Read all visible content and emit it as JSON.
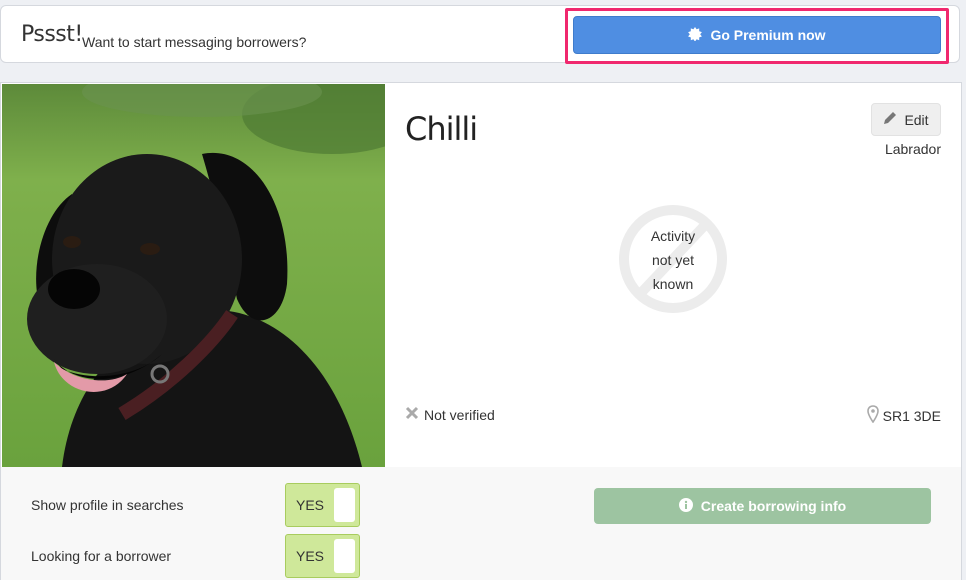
{
  "banner": {
    "prefix": "Pssst!",
    "message": "Want to start messaging borrowers?",
    "premium_button": "Go Premium now",
    "premium_icon": "badge-icon",
    "accent_color": "#4f8ee2",
    "highlight_color": "#f0286e"
  },
  "pet": {
    "name": "Chilli",
    "breed": "Labrador",
    "edit_label": "Edit",
    "activity_line1": "Activity",
    "activity_line2": "not yet",
    "activity_line3": "known",
    "verified_text": "Not verified",
    "postcode": "SR1 3DE"
  },
  "settings": {
    "show_profile_label": "Show profile in searches",
    "show_profile_value": "YES",
    "looking_label": "Looking for a borrower",
    "looking_value": "YES",
    "create_button": "Create borrowing info",
    "toggle_color": "#cfe89a",
    "create_button_color": "#9dc4a1"
  }
}
